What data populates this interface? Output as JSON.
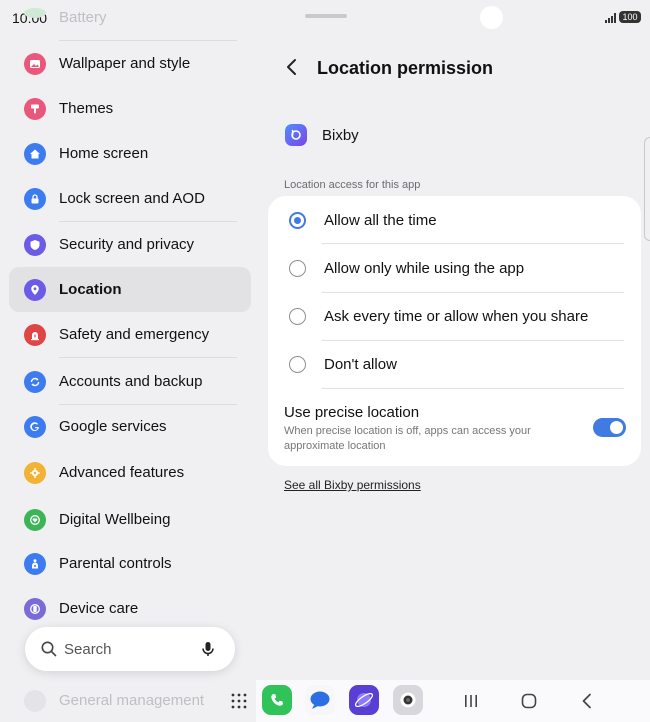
{
  "status_bar": {
    "time": "10:00",
    "battery": "100"
  },
  "left_list": {
    "faded_top": "Battery",
    "items": [
      {
        "label": "Wallpaper and style",
        "icon": "wallpaper-icon",
        "color": "#e9577a"
      },
      {
        "label": "Themes",
        "icon": "themes-icon",
        "color": "#e9577a"
      },
      {
        "label": "Home screen",
        "icon": "home-icon",
        "color": "#3d7cf0"
      },
      {
        "label": "Lock screen and AOD",
        "icon": "lock-icon",
        "color": "#3d7cf0"
      },
      {
        "label": "Security and privacy",
        "icon": "shield-icon",
        "color": "#6b5be6"
      },
      {
        "label": "Location",
        "icon": "location-pin-icon",
        "color": "#6b5be6"
      },
      {
        "label": "Safety and emergency",
        "icon": "emergency-icon",
        "color": "#e04545"
      },
      {
        "label": "Accounts and backup",
        "icon": "sync-icon",
        "color": "#3d7cf0"
      },
      {
        "label": "Google services",
        "icon": "google-icon",
        "color": "#3d7cf0"
      },
      {
        "label": "Advanced features",
        "icon": "gear-icon",
        "color": "#f2b233"
      },
      {
        "label": "Digital Wellbeing",
        "icon": "wellbeing-icon",
        "color": "#3cb556"
      },
      {
        "label": "Parental controls",
        "icon": "parental-icon",
        "color": "#3d7cf0"
      },
      {
        "label": "Device care",
        "icon": "device-care-icon",
        "color": "#7a6bd6"
      }
    ],
    "faded_bottom": "General management",
    "selected": "Location"
  },
  "search": {
    "placeholder": "Search"
  },
  "detail": {
    "title": "Location permission",
    "app_name": "Bixby",
    "section_header": "Location access for this app",
    "options": [
      {
        "label": "Allow all the time",
        "selected": true
      },
      {
        "label": "Allow only while using the app",
        "selected": false
      },
      {
        "label": "Ask every time or allow when you share",
        "selected": false
      },
      {
        "label": "Don't allow",
        "selected": false
      }
    ],
    "precise": {
      "title": "Use precise location",
      "description": "When precise location is off, apps can access your approximate location",
      "enabled": true
    },
    "link": "See all Bixby permissions"
  },
  "taskbar": {
    "apps": [
      "phone-icon",
      "messages-icon",
      "internet-icon",
      "camera-icon"
    ],
    "nav": [
      "recents-icon",
      "home-nav-icon",
      "back-nav-icon"
    ]
  },
  "colors": {
    "accent": "#3f7be0",
    "background": "#f0f0f3",
    "card": "#ffffff"
  }
}
